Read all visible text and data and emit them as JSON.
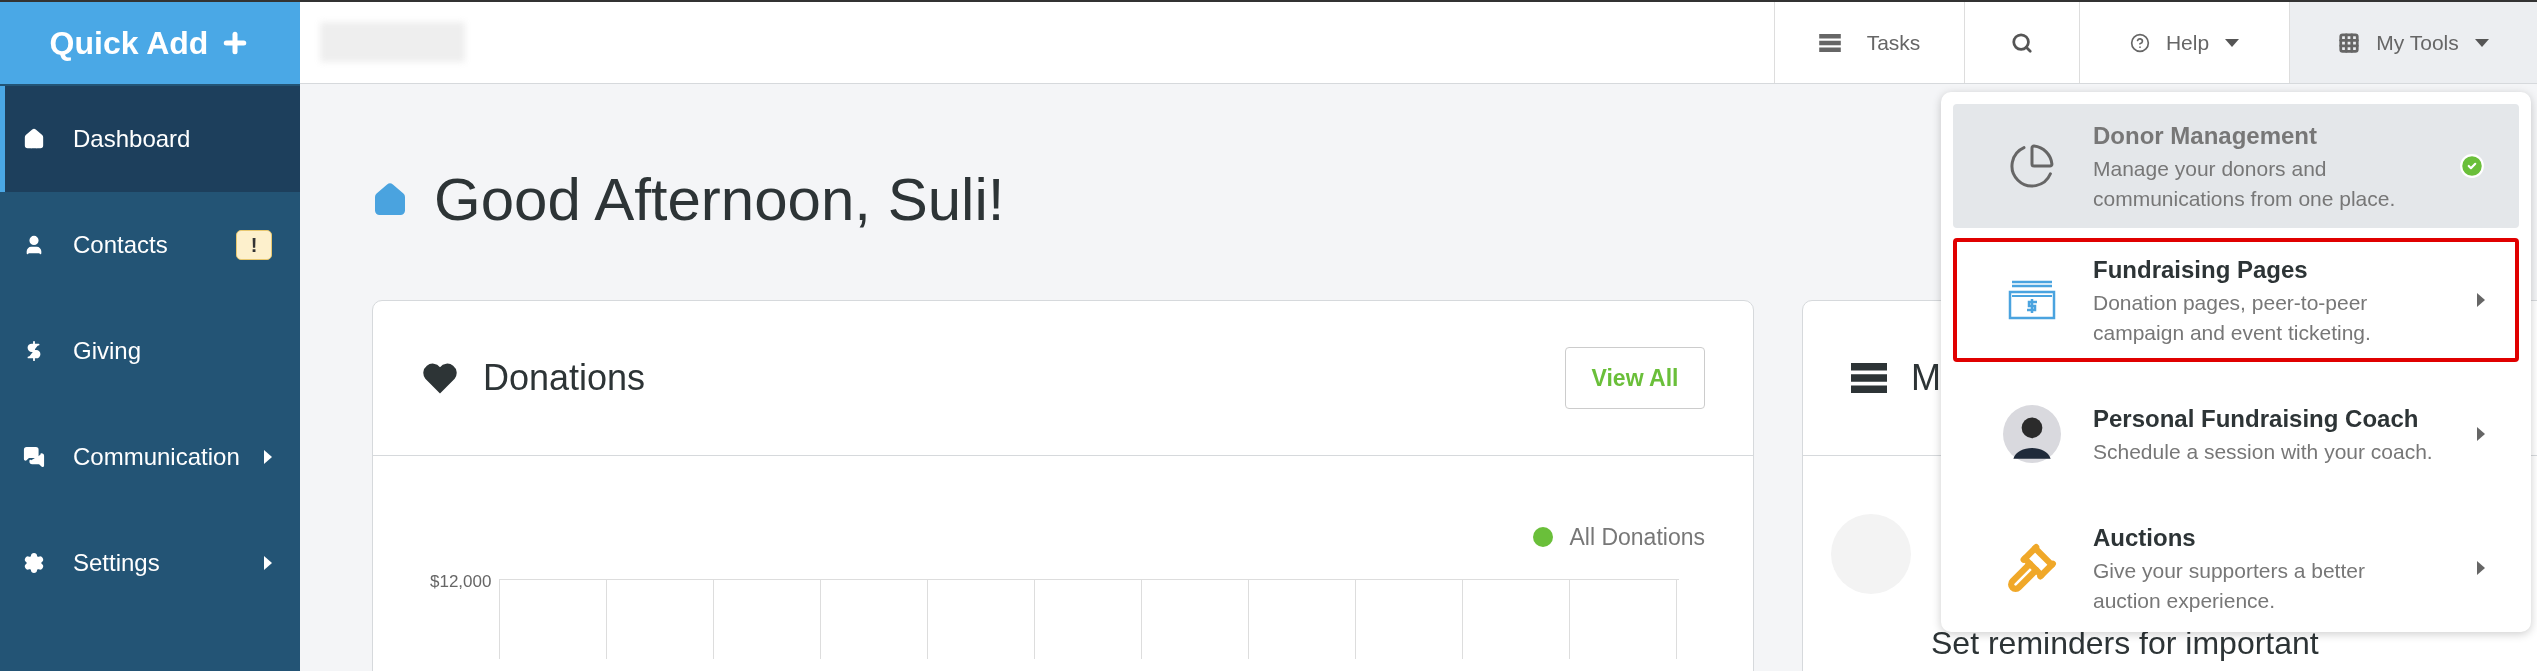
{
  "quick_add": {
    "label": "Quick Add"
  },
  "topbar": {
    "tasks": "Tasks",
    "help": "Help",
    "my_tools": {
      "label": "My Tools",
      "expanded": true
    }
  },
  "sidebar": {
    "items": [
      {
        "label": "Dashboard",
        "selected": true,
        "submenu": false
      },
      {
        "label": "Contacts",
        "selected": false,
        "submenu": false,
        "badge": "!"
      },
      {
        "label": "Giving",
        "selected": false,
        "submenu": false
      },
      {
        "label": "Communication",
        "selected": false,
        "submenu": true
      },
      {
        "label": "Settings",
        "selected": false,
        "submenu": true
      }
    ]
  },
  "greeting": "Good Afternoon, Suli!",
  "donations": {
    "title": "Donations",
    "button": "View All",
    "legend": {
      "label": "All Donations",
      "color": "#6abf3a"
    },
    "y_axis_label": "$12,000"
  },
  "second_card": {
    "title": "M",
    "text": "Set reminders for important"
  },
  "tools_menu": {
    "items": [
      {
        "title": "Donor Management",
        "description": "Manage your donors and communications from one place.",
        "selected": true,
        "highlighted": false,
        "submenu": false
      },
      {
        "title": "Fundraising Pages",
        "description": "Donation pages, peer-to-peer campaign and event ticketing.",
        "selected": false,
        "highlighted": true,
        "submenu": true
      },
      {
        "title": "Personal Fundraising Coach",
        "description": "Schedule a session with your coach.",
        "selected": false,
        "highlighted": false,
        "submenu": true
      },
      {
        "title": "Auctions",
        "description": "Give your supporters a better auction experience.",
        "selected": false,
        "highlighted": false,
        "submenu": true
      }
    ]
  }
}
